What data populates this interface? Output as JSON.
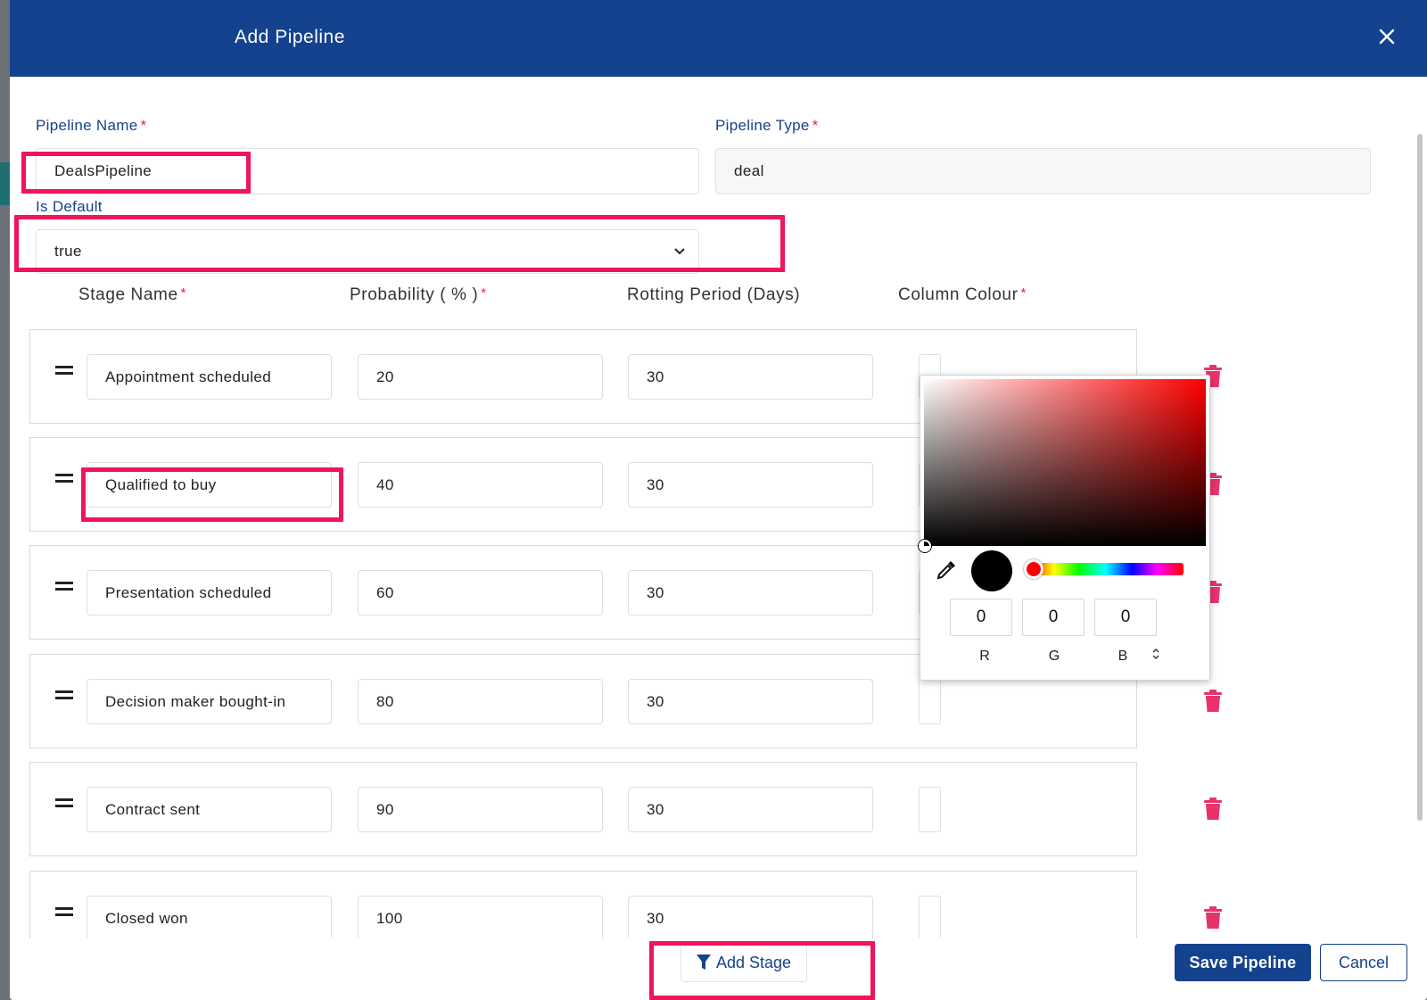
{
  "modal": {
    "title": "Add Pipeline",
    "close_icon": "close-icon"
  },
  "form": {
    "pipeline_name": {
      "label": "Pipeline Name",
      "required": "*",
      "value": "DealsPipeline"
    },
    "pipeline_type": {
      "label": "Pipeline Type",
      "required": "*",
      "value": "deal"
    },
    "is_default": {
      "label": "Is Default",
      "value": "true"
    }
  },
  "stages_header": {
    "stage_name": "Stage Name",
    "probability": "Probability ( % )",
    "rotting_period": "Rotting Period (Days)",
    "column_colour": "Column Colour",
    "required": "*"
  },
  "stages": [
    {
      "name": "Appointment scheduled",
      "probability": "20",
      "rotting": "30"
    },
    {
      "name": "Qualified to buy",
      "probability": "40",
      "rotting": "30"
    },
    {
      "name": "Presentation scheduled",
      "probability": "60",
      "rotting": "30"
    },
    {
      "name": "Decision maker bought-in",
      "probability": "80",
      "rotting": "30"
    },
    {
      "name": "Contract sent",
      "probability": "90",
      "rotting": "30"
    },
    {
      "name": "Closed won",
      "probability": "100",
      "rotting": "30"
    }
  ],
  "color_picker": {
    "r": "0",
    "g": "0",
    "b": "0",
    "r_label": "R",
    "g_label": "G",
    "b_label": "B",
    "hue_color": "#ff0000",
    "preview_color": "#000000"
  },
  "footer": {
    "add_stage": "Add Stage",
    "save": "Save Pipeline",
    "cancel": "Cancel"
  },
  "colors": {
    "header": "#15428e",
    "highlight": "#f0145a",
    "trash": "#e8336a"
  }
}
